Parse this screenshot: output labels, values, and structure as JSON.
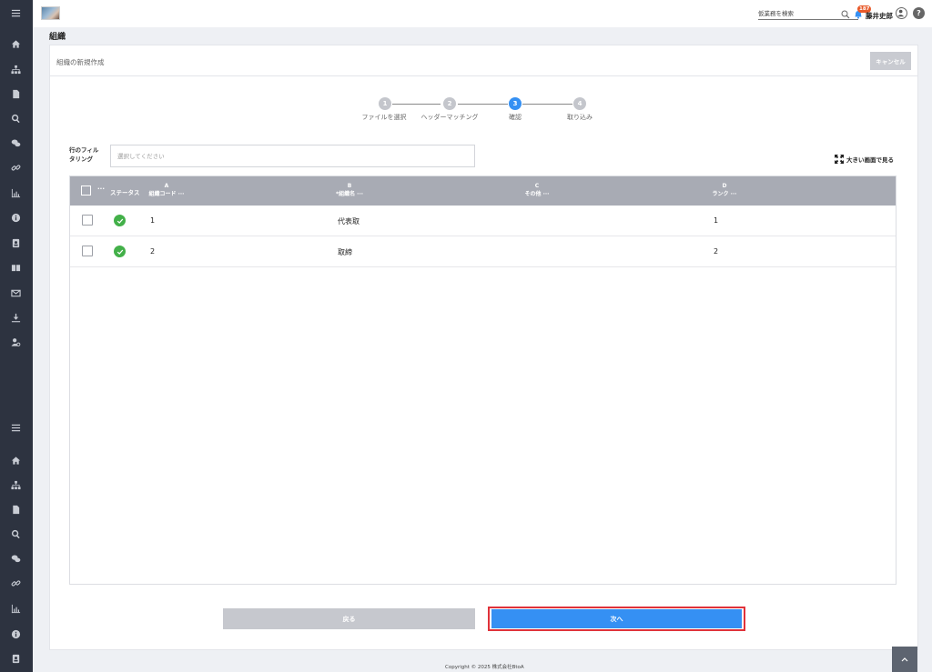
{
  "header": {
    "search_placeholder": "仮業務を検索",
    "notification_count": "187",
    "user_name": "藤井史郎",
    "help_label": "?"
  },
  "page": {
    "title": "組織",
    "card_title": "組織の新規作成",
    "cancel_label": "キャンセル"
  },
  "stepper": {
    "steps": [
      {
        "number": "1",
        "label": "ファイルを選択",
        "active": false
      },
      {
        "number": "2",
        "label": "ヘッダーマッチング",
        "active": false
      },
      {
        "number": "3",
        "label": "確認",
        "active": true
      },
      {
        "number": "4",
        "label": "取り込み",
        "active": false
      }
    ]
  },
  "filter": {
    "label_line1": "行のフィル",
    "label_line2": "タリング",
    "placeholder": "選択してください",
    "fullscreen_label": "大きい画面で見る"
  },
  "grid": {
    "header_menu": "···",
    "status_header": "ステータス",
    "columns": [
      {
        "letter": "A",
        "name": "組織コード ···"
      },
      {
        "letter": "B",
        "name": "*組織名 ···"
      },
      {
        "letter": "C",
        "name": "その他 ···"
      },
      {
        "letter": "D",
        "name": "ランク ···"
      }
    ],
    "rows": [
      {
        "code": "1",
        "name": "代表取",
        "rank": "1"
      },
      {
        "code": "2",
        "name": "取締",
        "rank": "2"
      }
    ]
  },
  "footer": {
    "back_label": "戻る",
    "next_label": "次へ",
    "copyright": "Copyright © 2025 株式会社BtoA"
  },
  "colors": {
    "sidebar": "#2d3340",
    "accent": "#3590f3",
    "success": "#43b049",
    "highlight": "#e0323a"
  }
}
